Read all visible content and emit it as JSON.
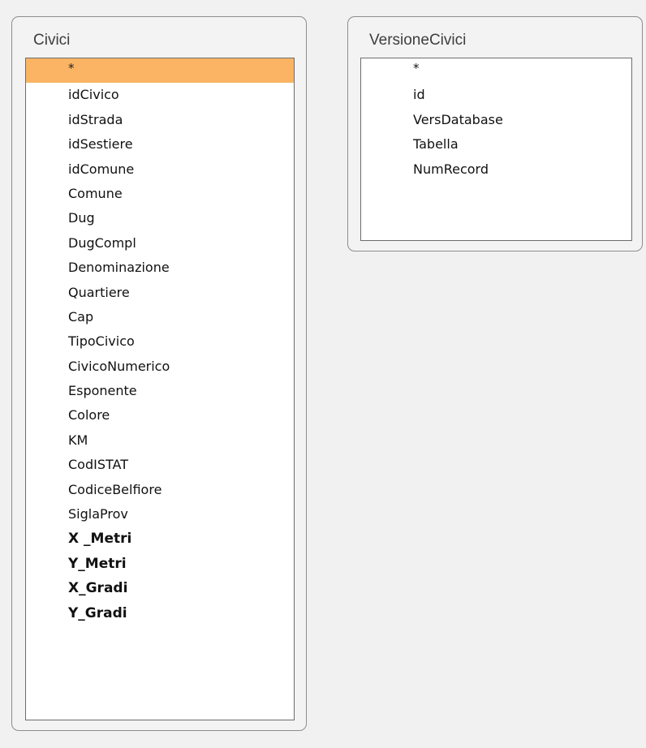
{
  "tables": {
    "civici": {
      "title": "Civici",
      "fields": [
        {
          "label": "*",
          "selected": true,
          "bold": false
        },
        {
          "label": "idCivico",
          "selected": false,
          "bold": false
        },
        {
          "label": "idStrada",
          "selected": false,
          "bold": false
        },
        {
          "label": "idSestiere",
          "selected": false,
          "bold": false
        },
        {
          "label": "idComune",
          "selected": false,
          "bold": false
        },
        {
          "label": "Comune",
          "selected": false,
          "bold": false
        },
        {
          "label": "Dug",
          "selected": false,
          "bold": false
        },
        {
          "label": "DugCompl",
          "selected": false,
          "bold": false
        },
        {
          "label": "Denominazione",
          "selected": false,
          "bold": false
        },
        {
          "label": "Quartiere",
          "selected": false,
          "bold": false
        },
        {
          "label": "Cap",
          "selected": false,
          "bold": false
        },
        {
          "label": "TipoCivico",
          "selected": false,
          "bold": false
        },
        {
          "label": "CivicoNumerico",
          "selected": false,
          "bold": false
        },
        {
          "label": "Esponente",
          "selected": false,
          "bold": false
        },
        {
          "label": "Colore",
          "selected": false,
          "bold": false
        },
        {
          "label": "KM",
          "selected": false,
          "bold": false
        },
        {
          "label": "CodISTAT",
          "selected": false,
          "bold": false
        },
        {
          "label": "CodiceBelfiore",
          "selected": false,
          "bold": false
        },
        {
          "label": "SiglaProv",
          "selected": false,
          "bold": false
        },
        {
          "label": "X _Metri",
          "selected": false,
          "bold": true
        },
        {
          "label": "Y_Metri",
          "selected": false,
          "bold": true
        },
        {
          "label": "X_Gradi",
          "selected": false,
          "bold": true
        },
        {
          "label": "Y_Gradi",
          "selected": false,
          "bold": true
        }
      ]
    },
    "versione_civici": {
      "title": "VersioneCivici",
      "fields": [
        {
          "label": "*",
          "selected": false,
          "bold": false
        },
        {
          "label": "id",
          "selected": false,
          "bold": false
        },
        {
          "label": "VersDatabase",
          "selected": false,
          "bold": false
        },
        {
          "label": "Tabella",
          "selected": false,
          "bold": false
        },
        {
          "label": "NumRecord",
          "selected": false,
          "bold": false
        }
      ]
    }
  },
  "colors": {
    "selection": "#fbb464",
    "panel_border": "#8d8d8d",
    "list_border": "#6d6d6d"
  }
}
